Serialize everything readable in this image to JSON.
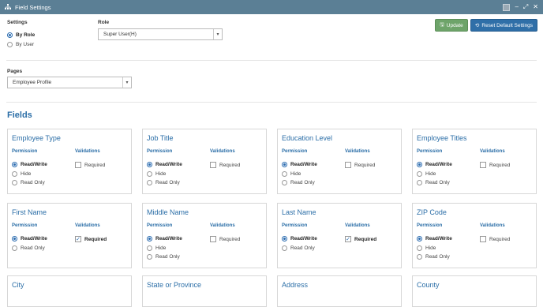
{
  "window": {
    "title": "Field Settings"
  },
  "settings": {
    "label": "Settings",
    "options": [
      {
        "label": "By Role",
        "selected": true
      },
      {
        "label": "By User",
        "selected": false
      }
    ]
  },
  "role": {
    "label": "Role",
    "value": "Super User(H)"
  },
  "pages": {
    "label": "Pages",
    "value": "Employee Profile"
  },
  "buttons": {
    "update": "Update",
    "reset": "Reset Default Settings"
  },
  "colors": {
    "titlebar": "#5b7f95",
    "accent": "#2b6ea7",
    "update": "#6ea46a",
    "reset": "#2f6fa8"
  },
  "fields_title": "Fields",
  "headers": {
    "permission": "Permission",
    "validations": "Validations"
  },
  "option_labels": {
    "readwrite": "Read/Write",
    "hide": "Hide",
    "readonly": "Read Only",
    "required": "Required"
  },
  "cards": [
    {
      "title": "Employee Type",
      "options": [
        "Read/Write",
        "Hide",
        "Read Only"
      ],
      "selected": 0,
      "required": false
    },
    {
      "title": "Job Title",
      "options": [
        "Read/Write",
        "Hide",
        "Read Only"
      ],
      "selected": 0,
      "required": false
    },
    {
      "title": "Education Level",
      "options": [
        "Read/Write",
        "Hide",
        "Read Only"
      ],
      "selected": 0,
      "required": false
    },
    {
      "title": "Employee Titles",
      "options": [
        "Read/Write",
        "Hide",
        "Read Only"
      ],
      "selected": 0,
      "required": false
    },
    {
      "title": "First Name",
      "options": [
        "Read/Write",
        "Read Only"
      ],
      "selected": 0,
      "required": true
    },
    {
      "title": "Middle Name",
      "options": [
        "Read/Write",
        "Hide",
        "Read Only"
      ],
      "selected": 0,
      "required": false
    },
    {
      "title": "Last Name",
      "options": [
        "Read/Write",
        "Read Only"
      ],
      "selected": 0,
      "required": true
    },
    {
      "title": "ZIP Code",
      "options": [
        "Read/Write",
        "Hide",
        "Read Only"
      ],
      "selected": 0,
      "required": false
    },
    {
      "title": "City",
      "options": [],
      "selected": 0,
      "required": false
    },
    {
      "title": "State or Province",
      "options": [],
      "selected": 0,
      "required": false
    },
    {
      "title": "Address",
      "options": [],
      "selected": 0,
      "required": false
    },
    {
      "title": "County",
      "options": [],
      "selected": 0,
      "required": false
    }
  ]
}
